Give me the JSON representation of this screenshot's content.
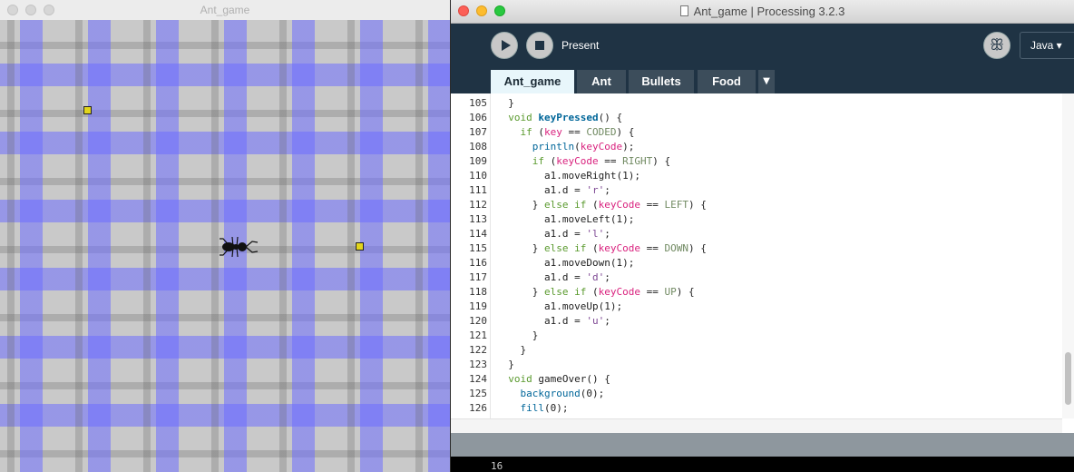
{
  "sketch": {
    "title": "Ant_game",
    "food_icon": "food-square",
    "ant_icon": "ant-sprite"
  },
  "ide": {
    "title": "Ant_game | Processing 3.2.3",
    "toolbar": {
      "run_icon": "play-icon",
      "stop_icon": "stop-icon",
      "present_label": "Present",
      "debug_icon": "butterfly-icon",
      "mode_label": "Java ▾"
    },
    "tabs": [
      {
        "label": "Ant_game",
        "active": true
      },
      {
        "label": "Ant",
        "active": false
      },
      {
        "label": "Bullets",
        "active": false
      },
      {
        "label": "Food",
        "active": false
      }
    ],
    "tab_menu": "▼",
    "code_lines": [
      {
        "n": "105",
        "text": "  }"
      },
      {
        "n": "106",
        "text": "  void keyPressed() {"
      },
      {
        "n": "107",
        "text": "    if (key == CODED) {"
      },
      {
        "n": "108",
        "text": "      println(keyCode);"
      },
      {
        "n": "109",
        "text": "      if (keyCode == RIGHT) {"
      },
      {
        "n": "110",
        "text": "        a1.moveRight(1);"
      },
      {
        "n": "111",
        "text": "        a1.d = 'r';"
      },
      {
        "n": "112",
        "text": "      } else if (keyCode == LEFT) {"
      },
      {
        "n": "113",
        "text": "        a1.moveLeft(1);"
      },
      {
        "n": "114",
        "text": "        a1.d = 'l';"
      },
      {
        "n": "115",
        "text": "      } else if (keyCode == DOWN) {"
      },
      {
        "n": "116",
        "text": "        a1.moveDown(1);"
      },
      {
        "n": "117",
        "text": "        a1.d = 'd';"
      },
      {
        "n": "118",
        "text": "      } else if (keyCode == UP) {"
      },
      {
        "n": "119",
        "text": "        a1.moveUp(1);"
      },
      {
        "n": "120",
        "text": "        a1.d = 'u';"
      },
      {
        "n": "121",
        "text": "      }"
      },
      {
        "n": "122",
        "text": "    }"
      },
      {
        "n": "123",
        "text": "  }"
      },
      {
        "n": "124",
        "text": "  void gameOver() {"
      },
      {
        "n": "125",
        "text": "    background(0);"
      },
      {
        "n": "126",
        "text": "    fill(0);"
      }
    ],
    "console_text": "16"
  }
}
